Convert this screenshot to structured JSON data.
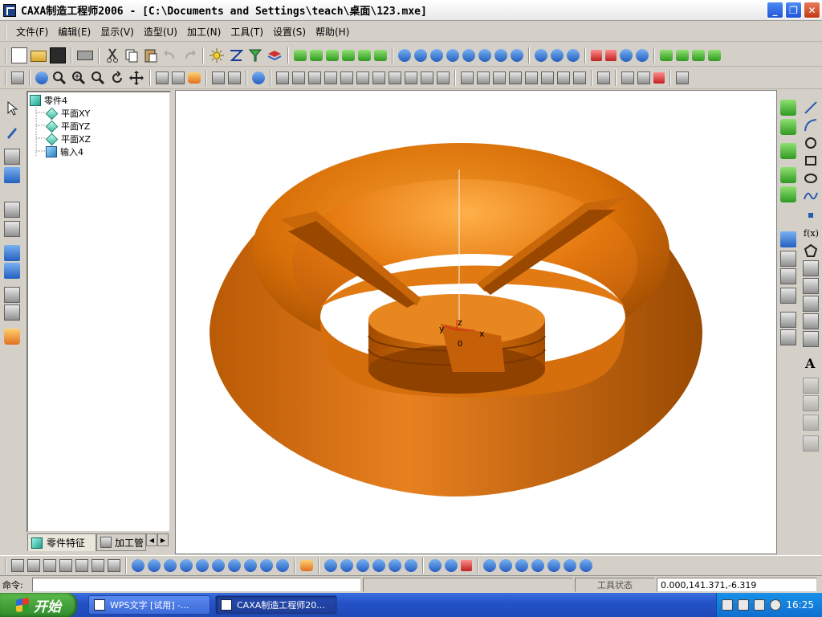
{
  "window": {
    "title": "CAXA制造工程师2006  - [C:\\Documents and Settings\\teach\\桌面\\123.mxe]",
    "buttons": [
      "_",
      "❐",
      "✕"
    ]
  },
  "menu": [
    "文件(F)",
    "编辑(E)",
    "显示(V)",
    "造型(U)",
    "加工(N)",
    "工具(T)",
    "设置(S)",
    "帮助(H)"
  ],
  "tree": {
    "root": "零件4",
    "children": [
      "平面XY",
      "平面YZ",
      "平面XZ",
      "输入4"
    ]
  },
  "tree_tabs": {
    "tab1": "零件特征",
    "tab2": "加工管"
  },
  "viewport": {
    "axis_labels": {
      "x": "x",
      "y": "y",
      "z": "z",
      "origin": "0"
    },
    "model_color": "#e07a10",
    "background": "#ffffff"
  },
  "statusbar": {
    "command_label": "命令:",
    "tool_state": "工具状态",
    "coords": "0.000,141.371,-6.319"
  },
  "taskbar": {
    "start": "开始",
    "items": [
      "WPS文字 [试用] -...",
      "CAXA制造工程师20..."
    ],
    "time": "16:25"
  }
}
